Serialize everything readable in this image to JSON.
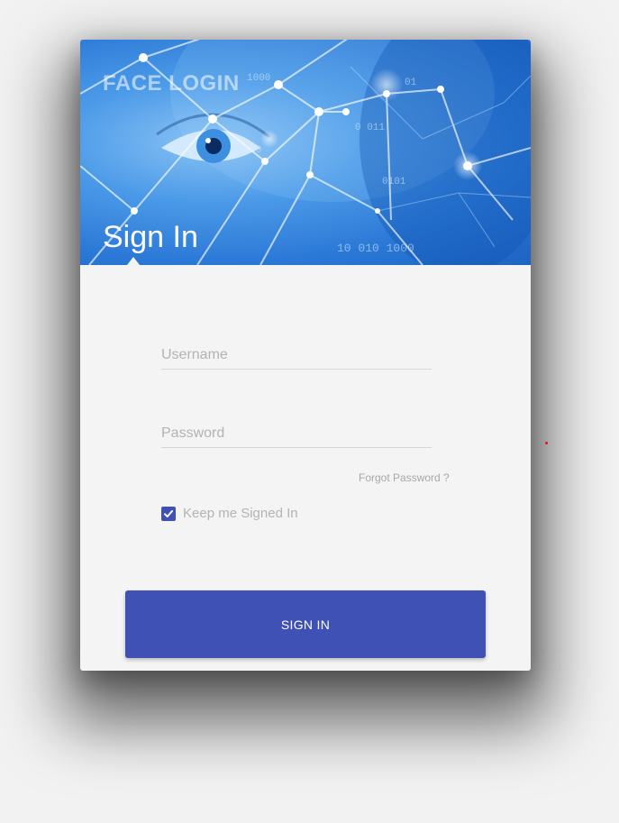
{
  "header": {
    "brand": "FACE LOGIN",
    "title": "Sign In"
  },
  "form": {
    "username": {
      "value": "",
      "placeholder": "Username"
    },
    "password": {
      "value": "",
      "placeholder": "Password"
    },
    "forgot_label": "Forgot Password ?",
    "keep_signed_in": {
      "label": "Keep me Signed In",
      "checked": true
    },
    "submit_label": "SIGN IN"
  },
  "colors": {
    "accent": "#3f51b5",
    "background": "#f2f2f2",
    "card": "#f4f4f4",
    "hero": "#2a78d6",
    "marker": "#e0141e"
  },
  "icons": {
    "checkbox": "check-icon"
  }
}
